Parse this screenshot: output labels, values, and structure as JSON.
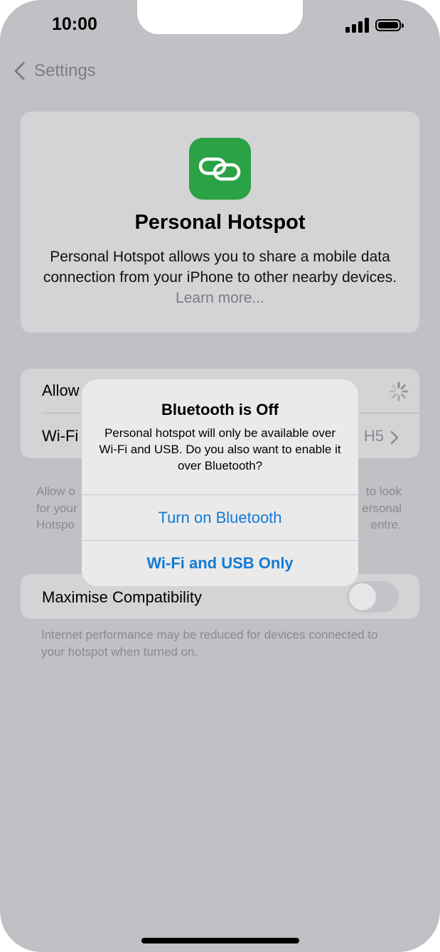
{
  "status_bar": {
    "time": "10:00",
    "signal_icon": "cellular-signal-icon",
    "battery_icon": "battery-icon"
  },
  "nav": {
    "back_label": "Settings",
    "back_icon": "chevron-left-icon"
  },
  "hotspot_card": {
    "icon": "link-chain-icon",
    "icon_color": "#2aa245",
    "title": "Personal Hotspot",
    "description": "Personal Hotspot allows you to share a mobile data connection from your iPhone to other nearby devices.",
    "learn_more": "Learn more..."
  },
  "settings_group": {
    "allow_row_label": "Allow",
    "allow_row_icon": "loading-spinner-icon",
    "wifi_row_label": "Wi-Fi",
    "wifi_row_value": "H5",
    "wifi_row_icon": "chevron-right-icon"
  },
  "footer_text": {
    "left_lines": [
      "Allow o",
      "for your",
      "Hotspo"
    ],
    "right_lines": [
      "to look",
      "ersonal",
      "entre."
    ]
  },
  "compatibility": {
    "label": "Maximise Compatibility",
    "toggle_on": false,
    "footer": "Internet performance may be reduced for devices connected to your hotspot when turned on."
  },
  "alert": {
    "title": "Bluetooth is Off",
    "message": "Personal hotspot will only be available over Wi-Fi and USB. Do you also want to enable it over Bluetooth?",
    "button_primary": "Turn on Bluetooth",
    "button_secondary": "Wi-Fi and USB Only",
    "accent_color": "#137bd3"
  }
}
